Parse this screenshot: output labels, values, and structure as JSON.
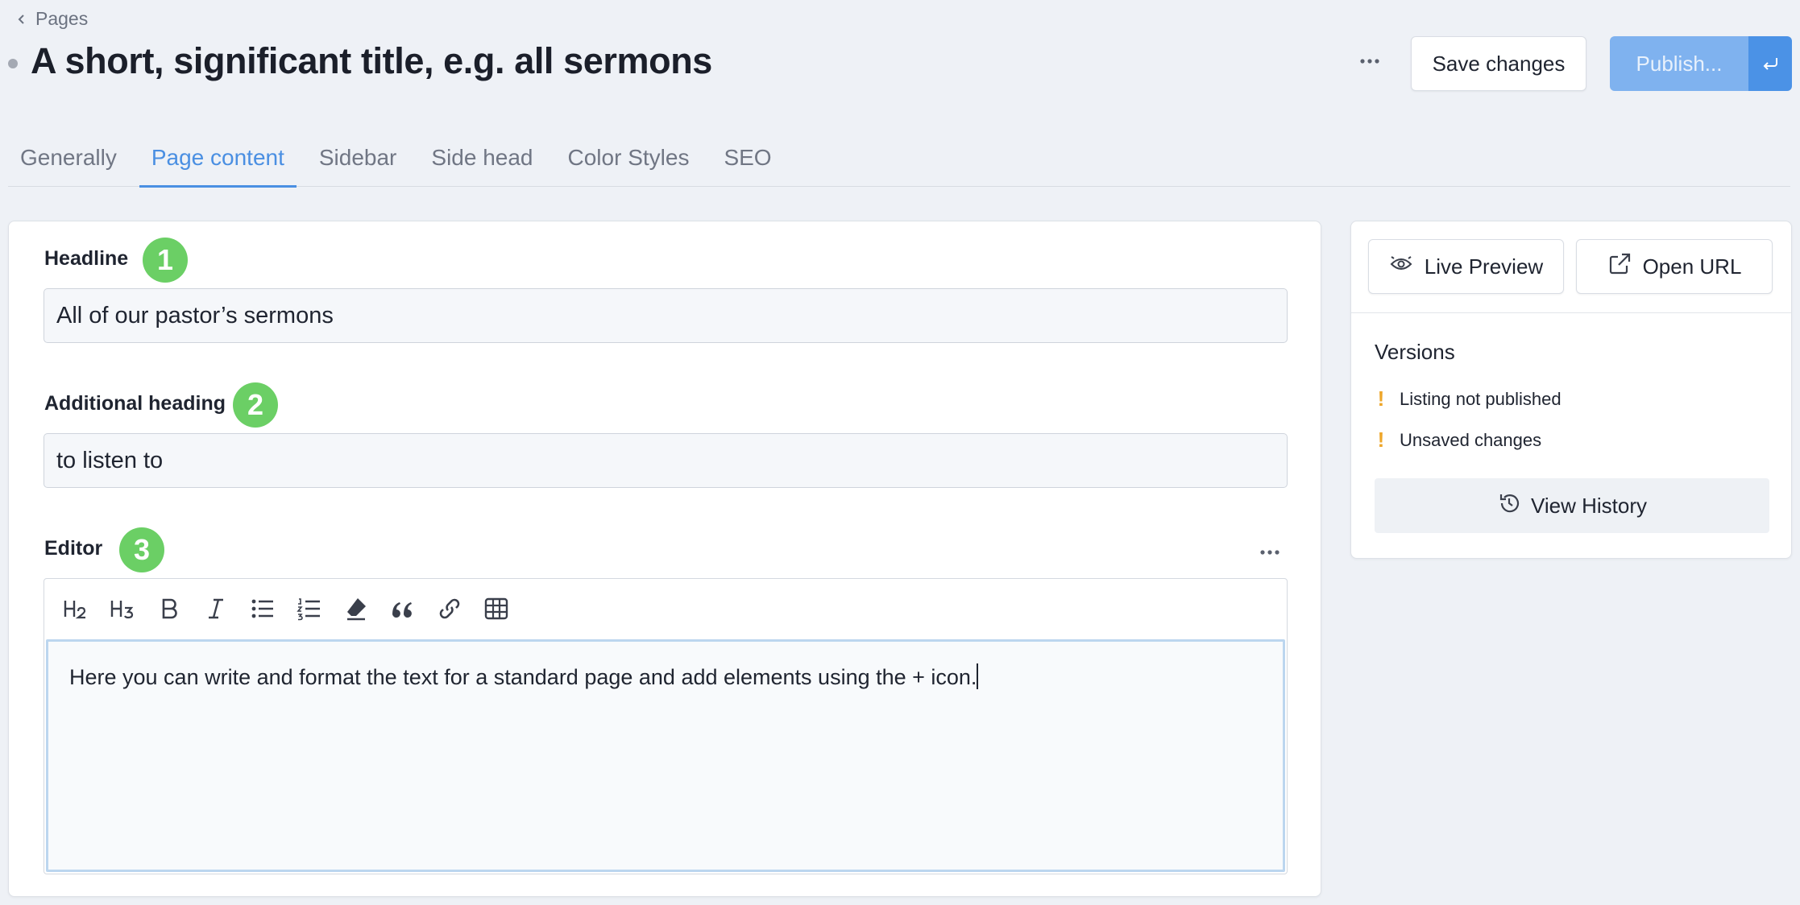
{
  "breadcrumb": {
    "label": "Pages"
  },
  "header": {
    "title": "A short, significant title, e.g. all sermons",
    "save_label": "Save changes",
    "publish_label": "Publish..."
  },
  "tabs": [
    {
      "label": "Generally"
    },
    {
      "label": "Page content"
    },
    {
      "label": "Sidebar"
    },
    {
      "label": "Side head"
    },
    {
      "label": "Color Styles"
    },
    {
      "label": "SEO"
    }
  ],
  "active_tab": "Page content",
  "fields": {
    "headline": {
      "label": "Headline",
      "value": "All of our pastor’s sermons",
      "step": "1"
    },
    "additional_heading": {
      "label": "Additional heading",
      "value": "to listen to",
      "step": "2"
    },
    "editor": {
      "label": "Editor",
      "step": "3",
      "content": "Here you can write and format the text for a standard page and add elements using the + icon."
    }
  },
  "toolbar_icons": [
    "heading-2-icon",
    "heading-3-icon",
    "bold-icon",
    "italic-icon",
    "bullet-list-icon",
    "numbered-list-icon",
    "clear-format-icon",
    "quote-icon",
    "link-icon",
    "table-icon"
  ],
  "sidebar": {
    "live_preview_label": "Live Preview",
    "open_url_label": "Open URL",
    "versions_title": "Versions",
    "versions": [
      {
        "mark": "!",
        "text": "Listing not published"
      },
      {
        "mark": "!",
        "text": "Unsaved changes"
      }
    ],
    "history_label": "View History"
  },
  "colors": {
    "accent": "#4a8fe2",
    "publish": "#7fb2ef",
    "publish_dark": "#4b92e6",
    "badge": "#6bcf65",
    "warning": "#eea629",
    "background": "#eef1f6"
  }
}
